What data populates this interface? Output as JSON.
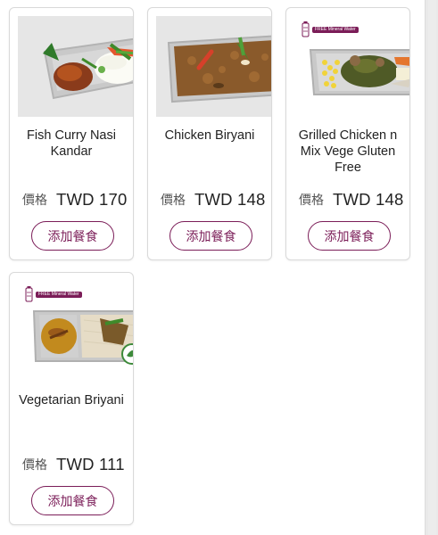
{
  "menu": {
    "items": [
      {
        "name": "Fish Curry Nasi Kandar",
        "price_label": "價格",
        "price": "TWD 170",
        "button_label": "添加餐食",
        "badge": null
      },
      {
        "name": "Chicken Biryani",
        "price_label": "價格",
        "price": "TWD 148",
        "button_label": "添加餐食",
        "badge": null
      },
      {
        "name": "Grilled Chicken n Mix Vege Gluten Free",
        "price_label": "價格",
        "price": "TWD 148",
        "button_label": "添加餐食",
        "badge": "FREE Mineral Water"
      },
      {
        "name": "Vegetarian Briyani",
        "price_label": "價格",
        "price": "TWD 111",
        "button_label": "添加餐食",
        "badge": "FREE Mineral Water"
      }
    ]
  },
  "colors": {
    "accent": "#7b1d58",
    "card_border": "#d9d9d9",
    "text": "#222222"
  }
}
